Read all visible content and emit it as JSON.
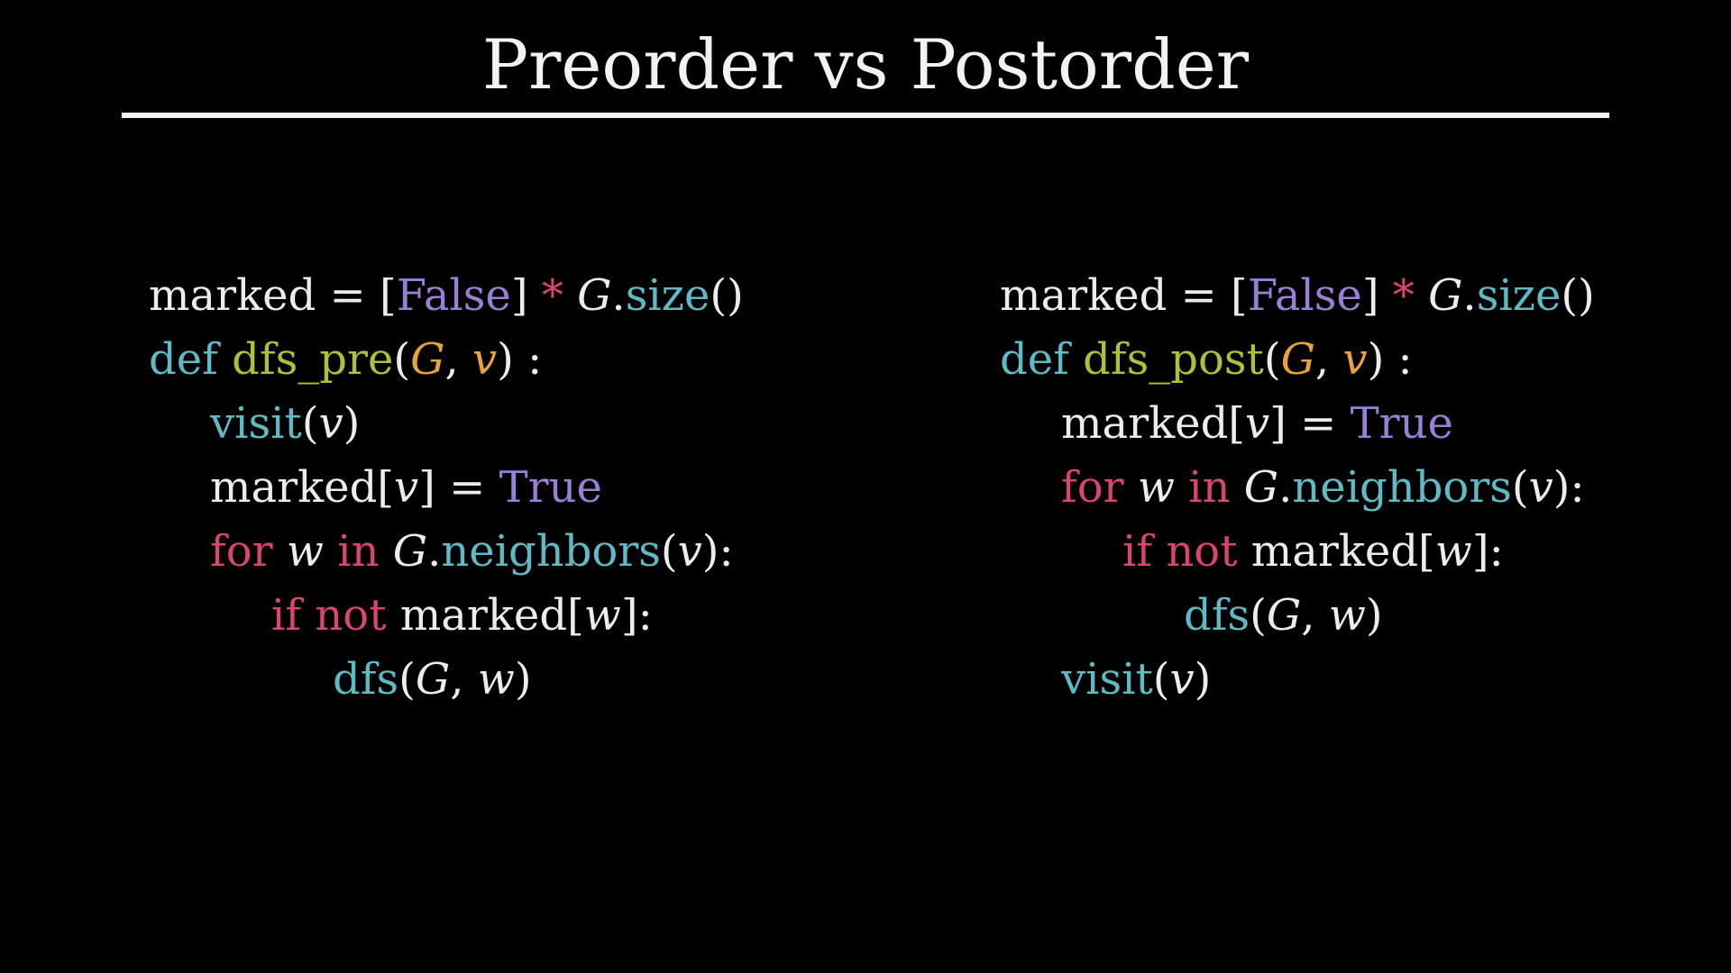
{
  "title": "Preorder vs Postorder",
  "colors": {
    "background": "#000000",
    "text": "#ececec",
    "builtin_teal": "#5fbac5",
    "function_green": "#a8c23a",
    "param_orange": "#e8a23a",
    "constant_purple": "#9a7fd6",
    "keyword_red": "#d9456d"
  },
  "left_code": [
    {
      "indent": 0,
      "tokens": [
        {
          "t": "marked = [",
          "c": "text"
        },
        {
          "t": "False",
          "c": "constant_purple"
        },
        {
          "t": "] ",
          "c": "text"
        },
        {
          "t": "*",
          "c": "keyword_red"
        },
        {
          "t": " ",
          "c": "text"
        },
        {
          "t": "G",
          "c": "text",
          "italic": true
        },
        {
          "t": ".",
          "c": "text"
        },
        {
          "t": "size",
          "c": "builtin_teal"
        },
        {
          "t": "()",
          "c": "text"
        }
      ]
    },
    {
      "indent": 0,
      "tokens": [
        {
          "t": "def",
          "c": "builtin_teal"
        },
        {
          "t": " ",
          "c": "text"
        },
        {
          "t": "dfs_pre",
          "c": "function_green"
        },
        {
          "t": "(",
          "c": "text"
        },
        {
          "t": "G",
          "c": "param_orange",
          "italic": true
        },
        {
          "t": ", ",
          "c": "text"
        },
        {
          "t": "v",
          "c": "param_orange",
          "italic": true
        },
        {
          "t": ") :",
          "c": "text"
        }
      ]
    },
    {
      "indent": 1,
      "tokens": [
        {
          "t": "visit",
          "c": "builtin_teal"
        },
        {
          "t": "(",
          "c": "text"
        },
        {
          "t": "v",
          "c": "text",
          "italic": true
        },
        {
          "t": ")",
          "c": "text"
        }
      ]
    },
    {
      "indent": 1,
      "tokens": [
        {
          "t": "marked[",
          "c": "text"
        },
        {
          "t": "v",
          "c": "text",
          "italic": true
        },
        {
          "t": "] = ",
          "c": "text"
        },
        {
          "t": "True",
          "c": "constant_purple"
        }
      ]
    },
    {
      "indent": 1,
      "tokens": [
        {
          "t": "for",
          "c": "keyword_red"
        },
        {
          "t": " ",
          "c": "text"
        },
        {
          "t": "w",
          "c": "text",
          "italic": true
        },
        {
          "t": " ",
          "c": "text"
        },
        {
          "t": "in",
          "c": "keyword_red"
        },
        {
          "t": " ",
          "c": "text"
        },
        {
          "t": "G",
          "c": "text",
          "italic": true
        },
        {
          "t": ".",
          "c": "text"
        },
        {
          "t": "neighbors",
          "c": "builtin_teal"
        },
        {
          "t": "(",
          "c": "text"
        },
        {
          "t": "v",
          "c": "text",
          "italic": true
        },
        {
          "t": "):",
          "c": "text"
        }
      ]
    },
    {
      "indent": 2,
      "tokens": [
        {
          "t": "if",
          "c": "keyword_red"
        },
        {
          "t": " ",
          "c": "text"
        },
        {
          "t": "not",
          "c": "keyword_red"
        },
        {
          "t": " marked[",
          "c": "text"
        },
        {
          "t": "w",
          "c": "text",
          "italic": true
        },
        {
          "t": "]:",
          "c": "text"
        }
      ]
    },
    {
      "indent": 3,
      "tokens": [
        {
          "t": "dfs",
          "c": "builtin_teal"
        },
        {
          "t": "(",
          "c": "text"
        },
        {
          "t": "G",
          "c": "text",
          "italic": true
        },
        {
          "t": ", ",
          "c": "text"
        },
        {
          "t": "w",
          "c": "text",
          "italic": true
        },
        {
          "t": ")",
          "c": "text"
        }
      ]
    }
  ],
  "right_code": [
    {
      "indent": 0,
      "tokens": [
        {
          "t": "marked = [",
          "c": "text"
        },
        {
          "t": "False",
          "c": "constant_purple"
        },
        {
          "t": "] ",
          "c": "text"
        },
        {
          "t": "*",
          "c": "keyword_red"
        },
        {
          "t": " ",
          "c": "text"
        },
        {
          "t": "G",
          "c": "text",
          "italic": true
        },
        {
          "t": ".",
          "c": "text"
        },
        {
          "t": "size",
          "c": "builtin_teal"
        },
        {
          "t": "()",
          "c": "text"
        }
      ]
    },
    {
      "indent": 0,
      "tokens": [
        {
          "t": "def",
          "c": "builtin_teal"
        },
        {
          "t": " ",
          "c": "text"
        },
        {
          "t": "dfs_post",
          "c": "function_green"
        },
        {
          "t": "(",
          "c": "text"
        },
        {
          "t": "G",
          "c": "param_orange",
          "italic": true
        },
        {
          "t": ", ",
          "c": "text"
        },
        {
          "t": "v",
          "c": "param_orange",
          "italic": true
        },
        {
          "t": ") :",
          "c": "text"
        }
      ]
    },
    {
      "indent": 1,
      "tokens": [
        {
          "t": "marked[",
          "c": "text"
        },
        {
          "t": "v",
          "c": "text",
          "italic": true
        },
        {
          "t": "] = ",
          "c": "text"
        },
        {
          "t": "True",
          "c": "constant_purple"
        }
      ]
    },
    {
      "indent": 1,
      "tokens": [
        {
          "t": "for",
          "c": "keyword_red"
        },
        {
          "t": " ",
          "c": "text"
        },
        {
          "t": "w",
          "c": "text",
          "italic": true
        },
        {
          "t": " ",
          "c": "text"
        },
        {
          "t": "in",
          "c": "keyword_red"
        },
        {
          "t": " ",
          "c": "text"
        },
        {
          "t": "G",
          "c": "text",
          "italic": true
        },
        {
          "t": ".",
          "c": "text"
        },
        {
          "t": "neighbors",
          "c": "builtin_teal"
        },
        {
          "t": "(",
          "c": "text"
        },
        {
          "t": "v",
          "c": "text",
          "italic": true
        },
        {
          "t": "):",
          "c": "text"
        }
      ]
    },
    {
      "indent": 2,
      "tokens": [
        {
          "t": "if",
          "c": "keyword_red"
        },
        {
          "t": " ",
          "c": "text"
        },
        {
          "t": "not",
          "c": "keyword_red"
        },
        {
          "t": " marked[",
          "c": "text"
        },
        {
          "t": "w",
          "c": "text",
          "italic": true
        },
        {
          "t": "]:",
          "c": "text"
        }
      ]
    },
    {
      "indent": 3,
      "tokens": [
        {
          "t": "dfs",
          "c": "builtin_teal"
        },
        {
          "t": "(",
          "c": "text"
        },
        {
          "t": "G",
          "c": "text",
          "italic": true
        },
        {
          "t": ", ",
          "c": "text"
        },
        {
          "t": "w",
          "c": "text",
          "italic": true
        },
        {
          "t": ")",
          "c": "text"
        }
      ]
    },
    {
      "indent": 1,
      "tokens": [
        {
          "t": "visit",
          "c": "builtin_teal"
        },
        {
          "t": "(",
          "c": "text"
        },
        {
          "t": "v",
          "c": "text",
          "italic": true
        },
        {
          "t": ")",
          "c": "text"
        }
      ]
    }
  ]
}
